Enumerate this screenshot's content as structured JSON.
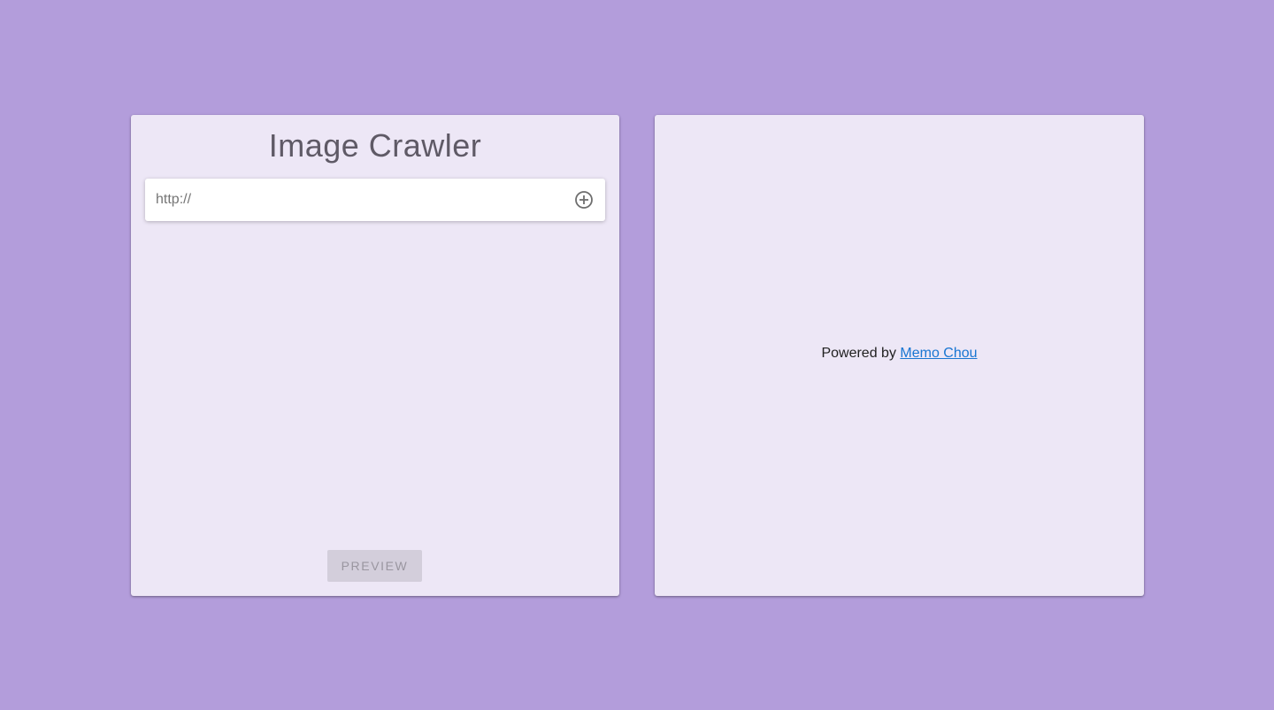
{
  "app": {
    "title": "Image Crawler"
  },
  "url_field": {
    "placeholder": "http://",
    "value": "",
    "add_icon": "add-circle-outline-icon"
  },
  "preview_button": {
    "label": "PREVIEW",
    "disabled": true
  },
  "footer": {
    "powered_prefix": "Powered by ",
    "author_link": "Memo Chou"
  },
  "colors": {
    "background": "#b39ddb",
    "card": "#ede7f6",
    "link": "#1976d2"
  }
}
